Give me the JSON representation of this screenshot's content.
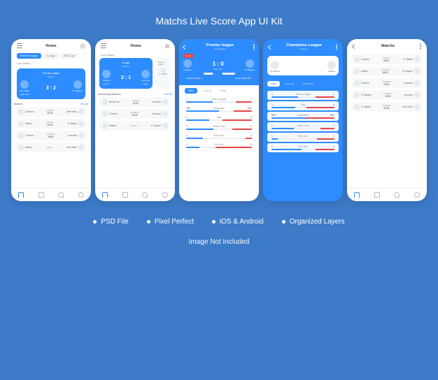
{
  "title": "Matchs Live Score App UI Kit",
  "features": [
    "PSD File",
    "Pixel Perfect",
    "iOS & Android",
    "Organized Layers"
  ],
  "disclaimer": "Image Not Included",
  "chips": {
    "premier": "Premier League",
    "liga": "La Liga",
    "afc": "AFC Cup"
  },
  "labels": {
    "home": "Home",
    "matchs": "Matchs",
    "live_match": "Live Match",
    "upcoming": "Upcoming Matches",
    "view_all": "View All",
    "premier_league": "Premier league",
    "la_liga": "La liga",
    "premier_title": "Premier league",
    "champions_title": "Champions League",
    "group_stage": "Group Stage",
    "week6": "Week 6",
    "week5": "Week 5",
    "week4": "Week 4",
    "live": "● Live"
  },
  "screen1": {
    "score": "3 : 2",
    "team1": "Inter Milan",
    "team2": "FC Bayern",
    "sub1": "Lukaku 45'",
    "sub2": "-",
    "list": [
      {
        "a": "Chelsea",
        "date": "4 March",
        "time": "20:00",
        "b": "Inter Milan"
      },
      {
        "a": "Atletico",
        "date": "8 March",
        "time": "20:00",
        "b": "R. Madrid"
      },
      {
        "a": "Chelsea",
        "date": "14 March",
        "time": "18:30",
        "b": "Juventus"
      },
      {
        "a": "Atletico",
        "date": "19 Oct",
        "time": "",
        "b": "Inter Milan"
      }
    ]
  },
  "screen2": {
    "score": "2 : 1",
    "team1": "Chelsea",
    "team2": "Juventus",
    "sub1": "Home",
    "sub2": "Away",
    "extra": {
      "title": "Premier league",
      "team1": "R. Madrid",
      "team2": "FC B"
    },
    "list": [
      {
        "a": "Barcelona",
        "date": "4 March",
        "time": "21:00",
        "b": "Juventus"
      },
      {
        "a": "Chelsea",
        "date": "14 March",
        "time": "20:00",
        "b": "Liverpool"
      },
      {
        "a": "Atletico",
        "date": "19 Oct",
        "time": "",
        "b": "R. Madrid"
      }
    ]
  },
  "screen3": {
    "score": "1 : 0",
    "team1": "Chelsea",
    "team2": "FC Bayern",
    "time": "Extra Time",
    "goals": {
      "l": "Christine Tyler ⚽ 7'",
      "r": "Gunther Beckn ⚽ 1'"
    },
    "tabs": [
      "Stats",
      "Line-up",
      "Table"
    ],
    "stats": [
      {
        "l": "2",
        "name": "Shot on Target",
        "r": "1",
        "lw": 40,
        "rw": 25
      },
      {
        "l": "45%",
        "name": "Possession",
        "r": "24%",
        "lw": 50,
        "rw": 28
      },
      {
        "l": "2",
        "name": "Shot",
        "r": "3",
        "lw": 35,
        "rw": 45
      },
      {
        "l": "3",
        "name": "Yellow Card",
        "r": "2",
        "lw": 42,
        "rw": 30
      },
      {
        "l": "1",
        "name": "Red Card",
        "r": "0",
        "lw": 25,
        "rw": 10
      },
      {
        "l": "1",
        "name": "Free Kick",
        "r": "5",
        "lw": 20,
        "rw": 55
      }
    ]
  },
  "screen4": {
    "team1": "FC Bayern",
    "team2": "Atletico",
    "tabs": [
      "Stats",
      "Line-up",
      "Summary"
    ],
    "stats": [
      {
        "l": "3",
        "name": "Shot on Target",
        "r": "2",
        "lw": 42,
        "rw": 30
      },
      {
        "l": "3",
        "name": "Shot",
        "r": "4",
        "lw": 38,
        "rw": 45
      },
      {
        "l": "55%",
        "name": "Possession",
        "r": "45%",
        "lw": 55,
        "rw": 45
      },
      {
        "l": "2",
        "name": "Yellow Card",
        "r": "1",
        "lw": 35,
        "rw": 22
      },
      {
        "l": "0",
        "name": "Red Card",
        "r": "1",
        "lw": 10,
        "rw": 28
      },
      {
        "l": "4",
        "name": "Free Kick",
        "r": "2",
        "lw": 48,
        "rw": 30
      }
    ]
  },
  "screen5": {
    "list": [
      {
        "a": "Chelsea",
        "date": "8 March",
        "time": "20:00",
        "b": "R. Madrid"
      },
      {
        "a": "Atletico",
        "date": "14 March",
        "time": "18:30",
        "b": "FC Bayern"
      },
      {
        "a": "Chelsea",
        "date": "15 March",
        "time": "20:00",
        "b": "Juventus"
      },
      {
        "a": "FC Bayern",
        "date": "17 March",
        "time": "20:00",
        "b": "Liverpool"
      },
      {
        "a": "R. Madrid",
        "date": "19 March",
        "time": "20:30",
        "b": "Inter Milan"
      }
    ]
  }
}
